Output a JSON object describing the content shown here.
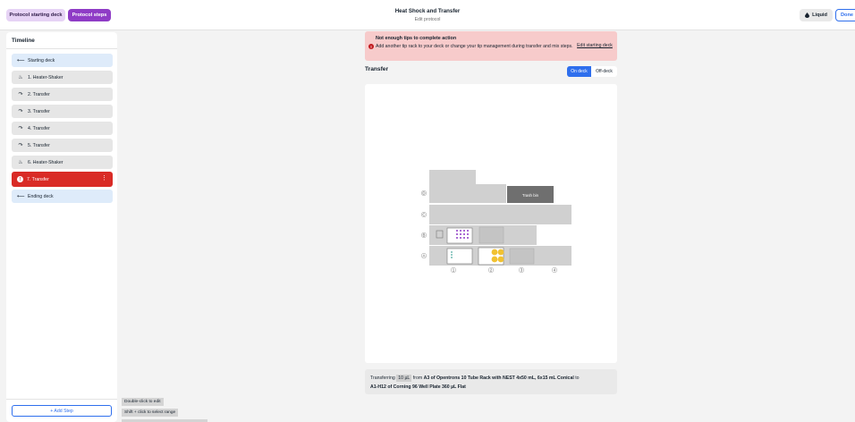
{
  "header": {
    "tab_setup": "Protocol starting deck",
    "tab_steps": "Protocol steps",
    "title": "Heat Shock and Transfer",
    "subtitle": "Edit protocol",
    "liquid_button": "Liquid",
    "done_button": "Done"
  },
  "timeline": {
    "title": "Timeline",
    "items": [
      {
        "label": "Starting deck",
        "icon": "arrow-icon"
      },
      {
        "label": "1. Heater-Shaker",
        "icon": "heater-shaker-icon"
      },
      {
        "label": "2. Transfer",
        "icon": "transfer-icon"
      },
      {
        "label": "3. Transfer",
        "icon": "transfer-icon"
      },
      {
        "label": "4. Transfer",
        "icon": "transfer-icon"
      },
      {
        "label": "5. Transfer",
        "icon": "transfer-icon"
      },
      {
        "label": "6. Heater-Shaker",
        "icon": "heater-shaker-icon"
      },
      {
        "label": "7. Transfer",
        "icon": "error-icon"
      },
      {
        "label": "Ending deck",
        "icon": "arrow-icon"
      }
    ],
    "add_step": "+ Add Step"
  },
  "hints": [
    "Double-click to edit",
    "Shift + click to select range"
  ],
  "banner": {
    "title": "Not enough tips to complete action",
    "body": "Add another tip rack to your deck or change your tip management during transfer and mix steps.",
    "link": "Edit starting deck"
  },
  "transfer": {
    "title": "Transfer",
    "toggle_on": "On deck",
    "toggle_off": "Off-deck"
  },
  "deck": {
    "trash_label": "Trash bin",
    "row_labels": [
      "D",
      "C",
      "B",
      "A"
    ],
    "col_labels": [
      "1",
      "2",
      "3",
      "4"
    ]
  },
  "footer": {
    "prefix": "Transferring",
    "volume": "10 µL",
    "from": "from",
    "source": "A3 of Opentrons 10 Tube Rack with NEST 4x50 mL, 6x15 mL Conical",
    "to": "to",
    "dest": "A1-H12 of Corning 96 Well Plate 360 µL Flat"
  },
  "colors": {
    "accent": "#2f6fed",
    "purple": "#8f3cc6",
    "error": "#d92b26"
  }
}
